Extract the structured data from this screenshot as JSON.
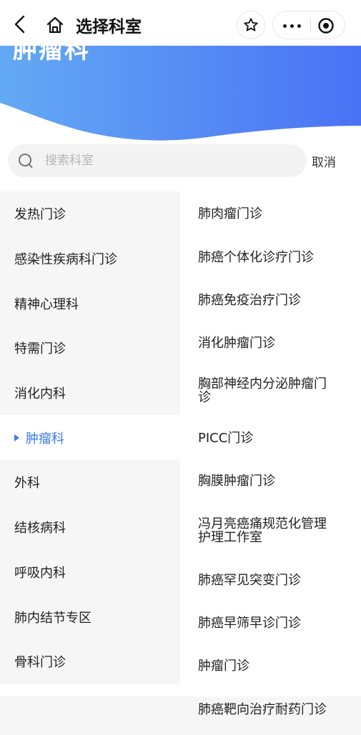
{
  "navbar": {
    "title": "选择科室",
    "back_icon": "chevron-left-icon",
    "home_icon": "home-icon",
    "star_icon": "star-outline-icon",
    "more_icon": "more-dots-icon",
    "close_icon": "target-circle-icon"
  },
  "banner": {
    "title": "肿瘤科",
    "gradient_from": "#63a9f4",
    "gradient_to": "#4a72f5"
  },
  "search": {
    "placeholder": "搜索科室",
    "cancel_label": "取消"
  },
  "colors": {
    "active_text": "#3a7bf0",
    "left_bg": "#f6f6f6"
  },
  "departments": [
    {
      "label": "发热门诊",
      "active": false
    },
    {
      "label": "感染性疾病科门诊",
      "active": false
    },
    {
      "label": "精神心理科",
      "active": false
    },
    {
      "label": "特需门诊",
      "active": false
    },
    {
      "label": "消化内科",
      "active": false
    },
    {
      "label": "肿瘤科",
      "active": true
    },
    {
      "label": "外科",
      "active": false
    },
    {
      "label": "结核病科",
      "active": false
    },
    {
      "label": "呼吸内科",
      "active": false
    },
    {
      "label": "肺内结节专区",
      "active": false
    },
    {
      "label": "骨科门诊",
      "active": false
    }
  ],
  "clinics": [
    {
      "lines": [
        "肺肉瘤门诊"
      ]
    },
    {
      "lines": [
        "肺癌个体化诊疗门诊"
      ]
    },
    {
      "lines": [
        "肺癌免疫治疗门诊"
      ]
    },
    {
      "lines": [
        "消化肿瘤门诊"
      ]
    },
    {
      "lines": [
        "胸部神经内分泌肿瘤门",
        "诊"
      ]
    },
    {
      "lines": [
        "PICC门诊"
      ]
    },
    {
      "lines": [
        "胸膜肿瘤门诊"
      ]
    },
    {
      "lines": [
        "冯月亮癌痛规范化管理",
        "护理工作室"
      ]
    },
    {
      "lines": [
        "肺癌罕见突变门诊"
      ]
    },
    {
      "lines": [
        "肺癌早筛早诊门诊"
      ]
    },
    {
      "lines": [
        "肿瘤门诊"
      ]
    },
    {
      "lines": [
        "肺癌靶向治疗耐药门诊"
      ]
    }
  ]
}
